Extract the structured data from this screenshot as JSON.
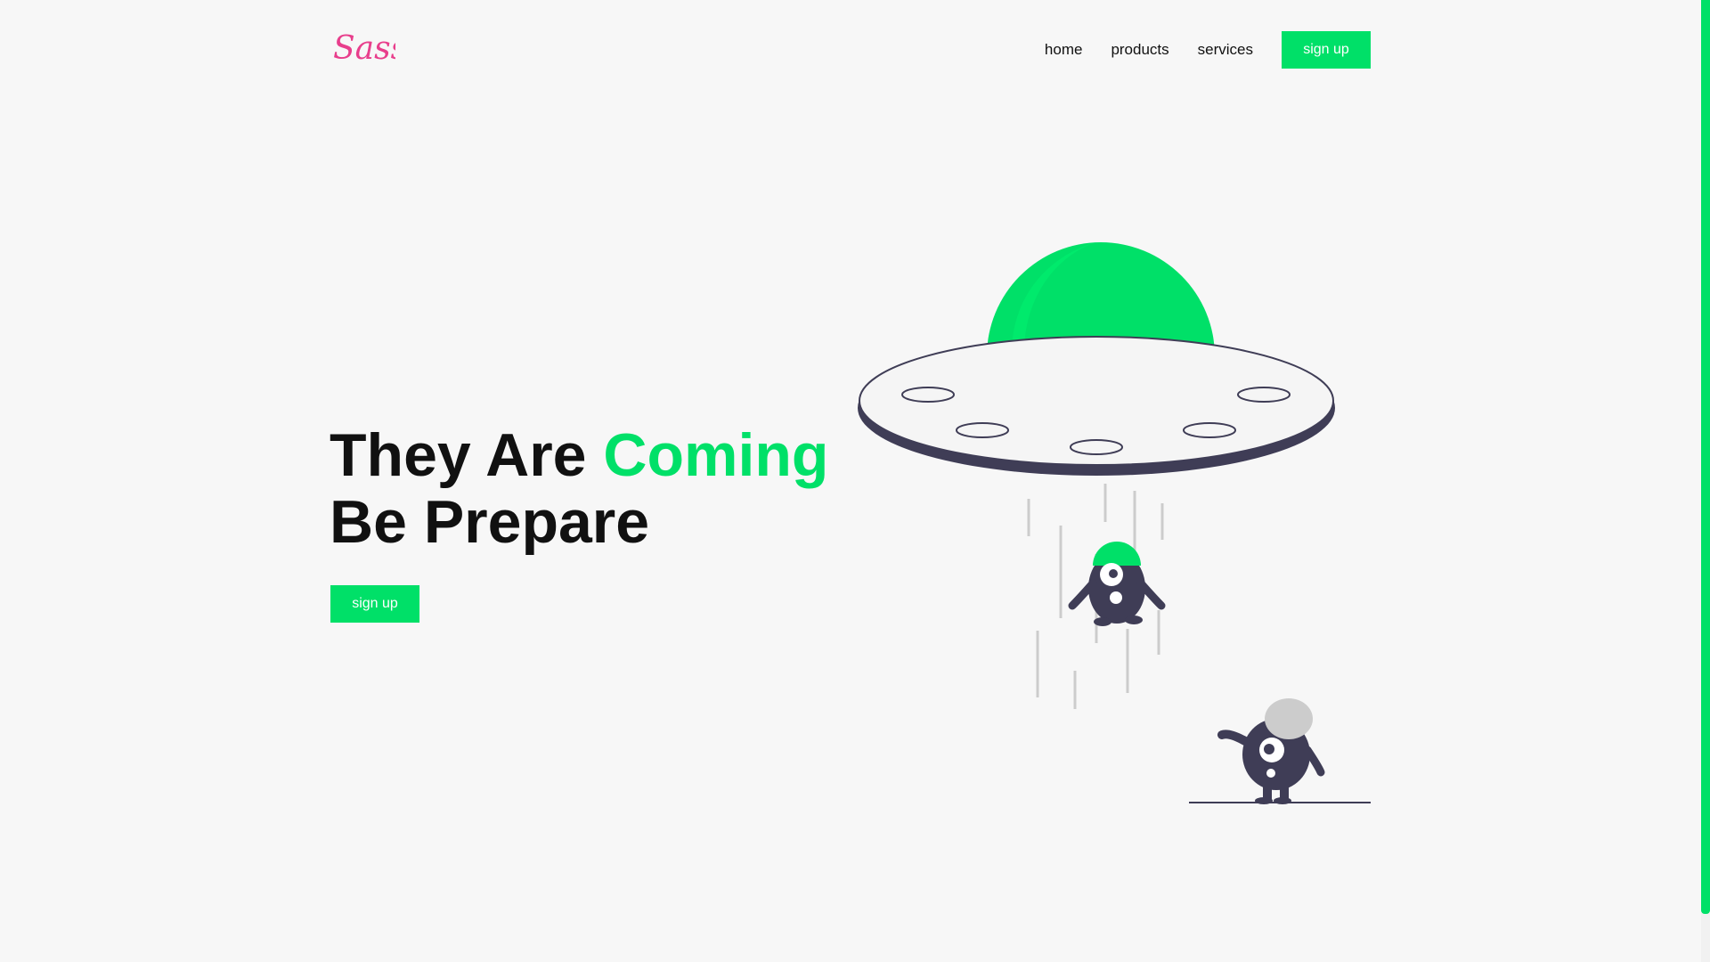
{
  "logo": {
    "text": "Sass",
    "icon": "sass-logo-icon",
    "color": "#e83e8c"
  },
  "nav": {
    "links": [
      "home",
      "products",
      "services"
    ],
    "signup_label": "sign up"
  },
  "hero": {
    "line1_prefix": "They Are ",
    "line1_accent": "Coming",
    "line2": "Be Prepare",
    "signup_label": "sign up"
  },
  "colors": {
    "accent": "#00e068",
    "dark": "#3f3d56",
    "text": "#111111",
    "gray": "#cccccc",
    "background": "#f7f7f7"
  },
  "illustration": {
    "icon": "ufo-abduction-illustration"
  }
}
